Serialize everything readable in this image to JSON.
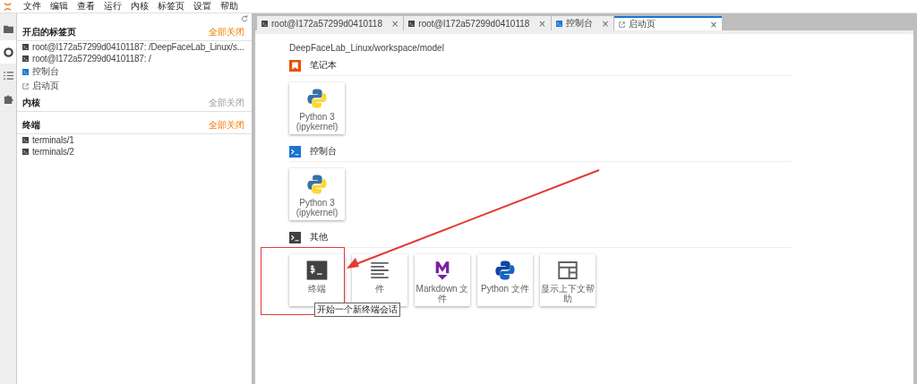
{
  "menu": [
    "文件",
    "编辑",
    "查看",
    "运行",
    "内核",
    "标签页",
    "设置",
    "帮助"
  ],
  "left_rail": [
    {
      "kind": "folder",
      "selected": false
    },
    {
      "kind": "running",
      "selected": true
    },
    {
      "kind": "toc",
      "selected": false
    },
    {
      "kind": "extension",
      "selected": false
    }
  ],
  "sidebar": {
    "sections": [
      {
        "title": "开启的标签页",
        "action": "全部关闭",
        "enabled": true,
        "items": [
          {
            "label": "root@I172a57299d04101187: /DeepFaceLab_Linux/s...",
            "kind": "terminal"
          },
          {
            "label": "root@I172a57299d04101187: /",
            "kind": "terminal"
          },
          {
            "label": "控制台",
            "kind": "console"
          },
          {
            "label": "启动页",
            "kind": "launcher"
          }
        ]
      },
      {
        "title": "内核",
        "action": "全部关闭",
        "enabled": false
      },
      {
        "title": "终端",
        "action": "全部关闭",
        "enabled": true,
        "items": [
          {
            "label": "terminals/1",
            "kind": "terminal"
          },
          {
            "label": "terminals/2",
            "kind": "terminal"
          }
        ]
      }
    ]
  },
  "tabs": [
    {
      "label": "root@I172a57299d0410118",
      "kind": "terminal",
      "close": "×",
      "selected": false
    },
    {
      "label": "root@I172a57299d0410118",
      "kind": "terminal",
      "close": "×",
      "selected": false
    },
    {
      "label": "控制台",
      "kind": "console",
      "close": "×",
      "selected": false
    },
    {
      "label": "启动页",
      "kind": "launcher",
      "close": "×",
      "selected": true
    }
  ],
  "launcher": {
    "path": "DeepFaceLab_Linux/workspace/model",
    "sections": [
      {
        "title": "笔记本",
        "kind": "notebook",
        "items": [
          {
            "lines": [
              "Python 3",
              "(ipykernel)"
            ],
            "kind": "python"
          }
        ]
      },
      {
        "title": "控制台",
        "kind": "console",
        "items": [
          {
            "lines": [
              "Python 3",
              "(ipykernel)"
            ],
            "kind": "python"
          }
        ]
      },
      {
        "title": "其他",
        "kind": "terminal",
        "items": [
          {
            "lines": [
              "终端"
            ],
            "kind": "terminal"
          },
          {
            "lines": [
              "件"
            ],
            "kind": "text"
          },
          {
            "lines": [
              "Markdown 文件"
            ],
            "kind": "markdown"
          },
          {
            "lines": [
              "Python 文件"
            ],
            "kind": "pyfile"
          },
          {
            "lines": [
              "显示上下文帮助"
            ],
            "kind": "help"
          }
        ]
      }
    ]
  },
  "tooltip": "开始一个新终端会话"
}
